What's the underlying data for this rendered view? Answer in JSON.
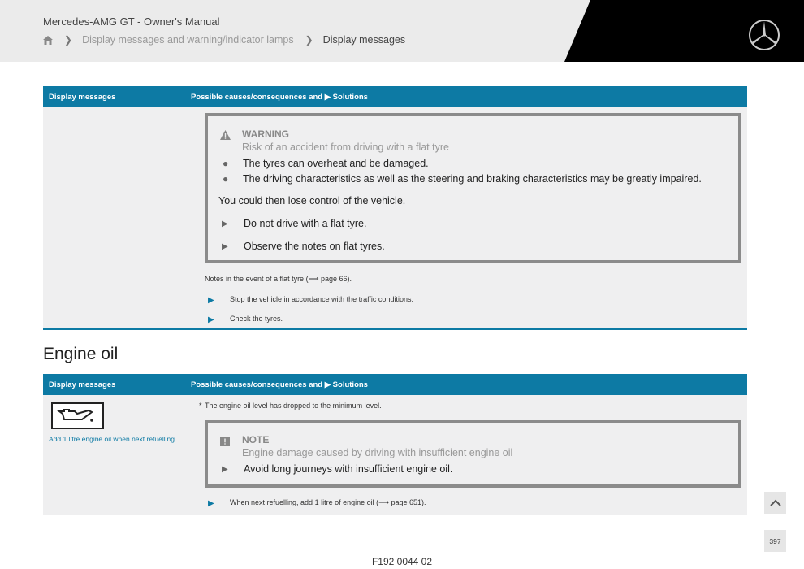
{
  "header": {
    "manual_title": "Mercedes-AMG GT - Owner's Manual",
    "breadcrumb": [
      "Display messages and warning/indicator lamps",
      "Display messages"
    ]
  },
  "table_header": {
    "col1": "Display messages",
    "col2": "Possible causes/consequences and ▶ Solutions"
  },
  "section1": {
    "warning": {
      "title": "WARNING",
      "subtitle": "Risk of an accident from driving with a flat tyre",
      "bullets": [
        "The tyres can overheat and be damaged.",
        "The driving characteristics as well as the steering and braking characteristics may be greatly impaired."
      ],
      "consequence": "You could then lose control of the vehicle.",
      "actions": [
        "Do not drive with a flat tyre.",
        "Observe the notes on flat tyres."
      ]
    },
    "notes_text": "Notes in the event of a flat tyre (⟶ page 66).",
    "steps": [
      "Stop the vehicle in accordance with the traffic conditions.",
      "Check the tyres."
    ]
  },
  "heading": "Engine oil",
  "section2": {
    "message_label": "Add 1 litre engine oil when next refuelling",
    "cause": "The engine oil level has dropped to the minimum level.",
    "note": {
      "title": "NOTE",
      "subtitle": "Engine damage caused by driving with insufficient engine oil",
      "action": "Avoid long journeys with insufficient engine oil."
    },
    "step": "When next refuelling, add 1 litre of engine oil (⟶ page 651)."
  },
  "page_number": "397",
  "footer_code": "F192 0044 02"
}
